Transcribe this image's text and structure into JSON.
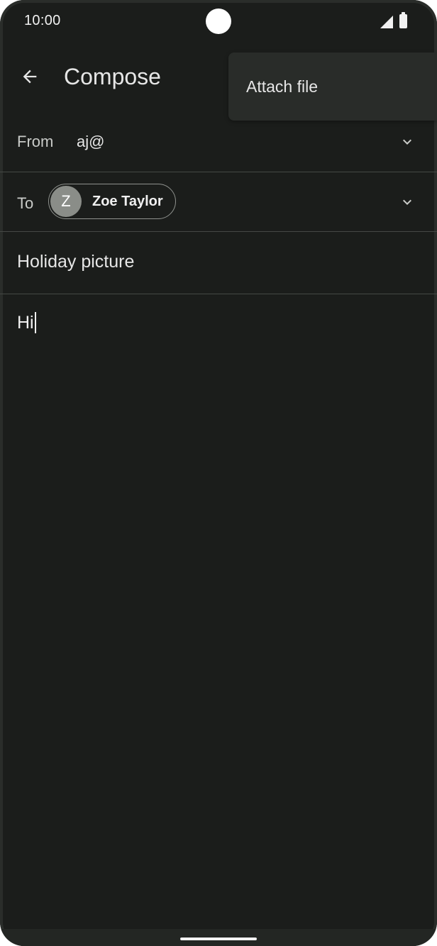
{
  "status_bar": {
    "time": "10:00",
    "icons": [
      "signal-icon",
      "battery-icon"
    ]
  },
  "app_bar": {
    "title": "Compose",
    "back_icon": "arrow-left-icon"
  },
  "menu": {
    "items": [
      {
        "label": "Attach file"
      }
    ]
  },
  "compose": {
    "from": {
      "label": "From",
      "value": "aj@",
      "icon": "chevron-down-icon"
    },
    "to": {
      "label": "To",
      "recipient": {
        "initial": "Z",
        "name": "Zoe Taylor"
      },
      "icon": "chevron-down-icon"
    },
    "subject": "Holiday picture",
    "body": "Hi"
  },
  "colors": {
    "background": "#1b1d1b",
    "menu_surface": "#292c29",
    "divider": "#454845",
    "text_primary": "#e6e6e6",
    "avatar": "#8a8d88"
  }
}
